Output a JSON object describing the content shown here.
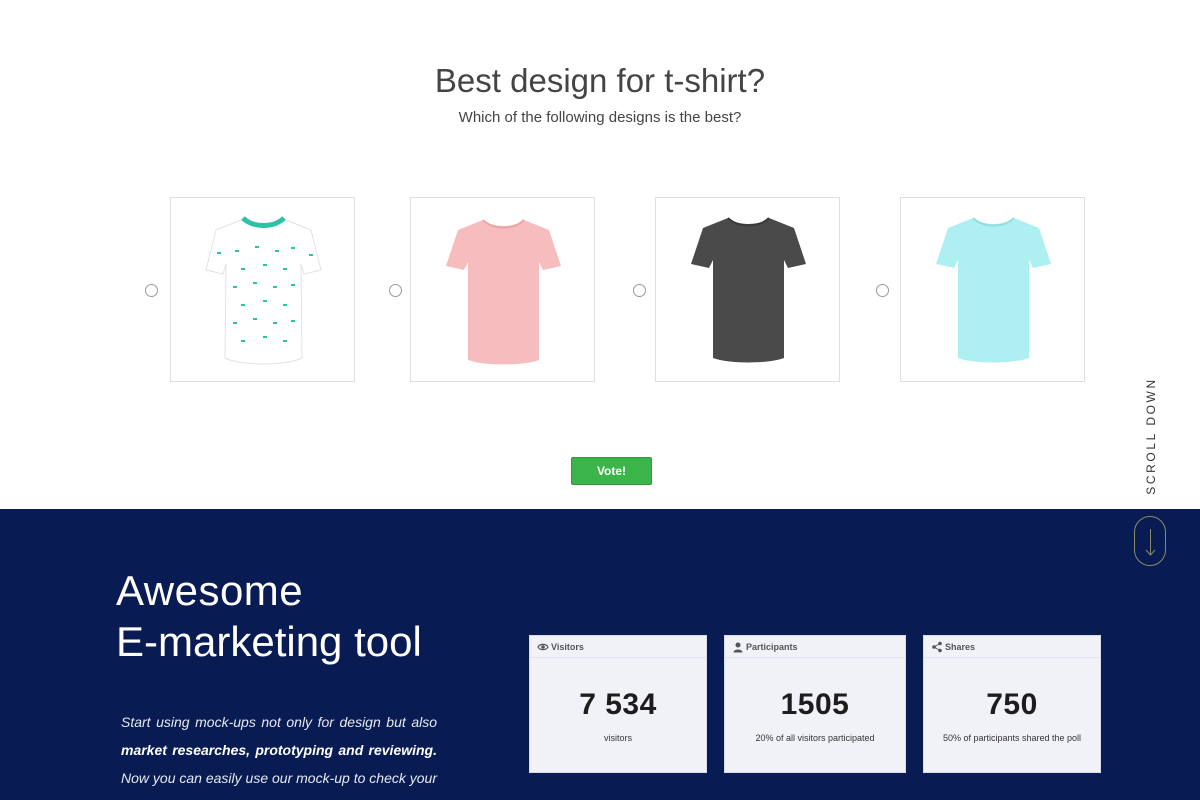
{
  "poll": {
    "title": "Best design for t-shirt?",
    "subtitle": "Which of the following designs is the best?",
    "options": [
      {
        "color": "#ffffff",
        "accent": "#2bc2a5",
        "pattern": "dotted"
      },
      {
        "color": "#f7bcbe"
      },
      {
        "color": "#4a4a4a"
      },
      {
        "color": "#aef0f2"
      }
    ],
    "vote_label": "Vote!"
  },
  "scroll": {
    "label": "SCROLL DOWN"
  },
  "marketing": {
    "heading_light": "Awesome",
    "heading_bold": "E-marketing tool",
    "desc_intro": "Start using mock-ups not only for design but also ",
    "desc_bold": "market researches, prototyping and reviewing.",
    "desc_rest": " Now you can easily use our mock-up to check your customers’ reactions."
  },
  "stats": [
    {
      "icon": "eye-icon",
      "title": "Visitors",
      "value": "7 534",
      "label": "visitors"
    },
    {
      "icon": "user-icon",
      "title": "Participants",
      "value": "1505",
      "label": "20% of all visitors participated"
    },
    {
      "icon": "share-icon",
      "title": "Shares",
      "value": "750",
      "label": "50% of participants shared the poll"
    }
  ],
  "colors": {
    "navy": "#081c53",
    "vote_green": "#3bb44a"
  }
}
